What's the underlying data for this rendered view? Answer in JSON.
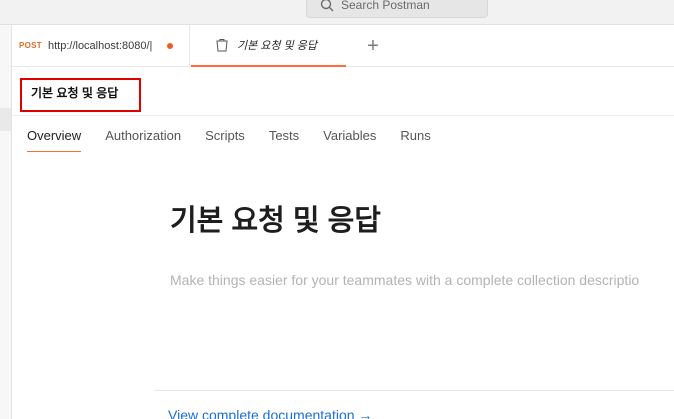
{
  "search": {
    "placeholder": "Search Postman"
  },
  "tabs": {
    "request": {
      "method": "POST",
      "url": "http://localhost:8080/|"
    },
    "collection": {
      "label": "기본 요청 및 응답"
    },
    "new_tab": "+"
  },
  "header": {
    "title": "기본 요청 및 응답"
  },
  "subtabs": [
    "Overview",
    "Authorization",
    "Scripts",
    "Tests",
    "Variables",
    "Runs"
  ],
  "overview": {
    "title": "기본 요청 및 응답",
    "description_placeholder": "Make things easier for your teammates with a complete collection descriptio",
    "documentation_link": "View complete documentation →"
  },
  "colors": {
    "accent": "#ff6c37",
    "method_post": "#e06e2c",
    "highlight_border": "#e00000",
    "link": "#1a6dd6"
  }
}
